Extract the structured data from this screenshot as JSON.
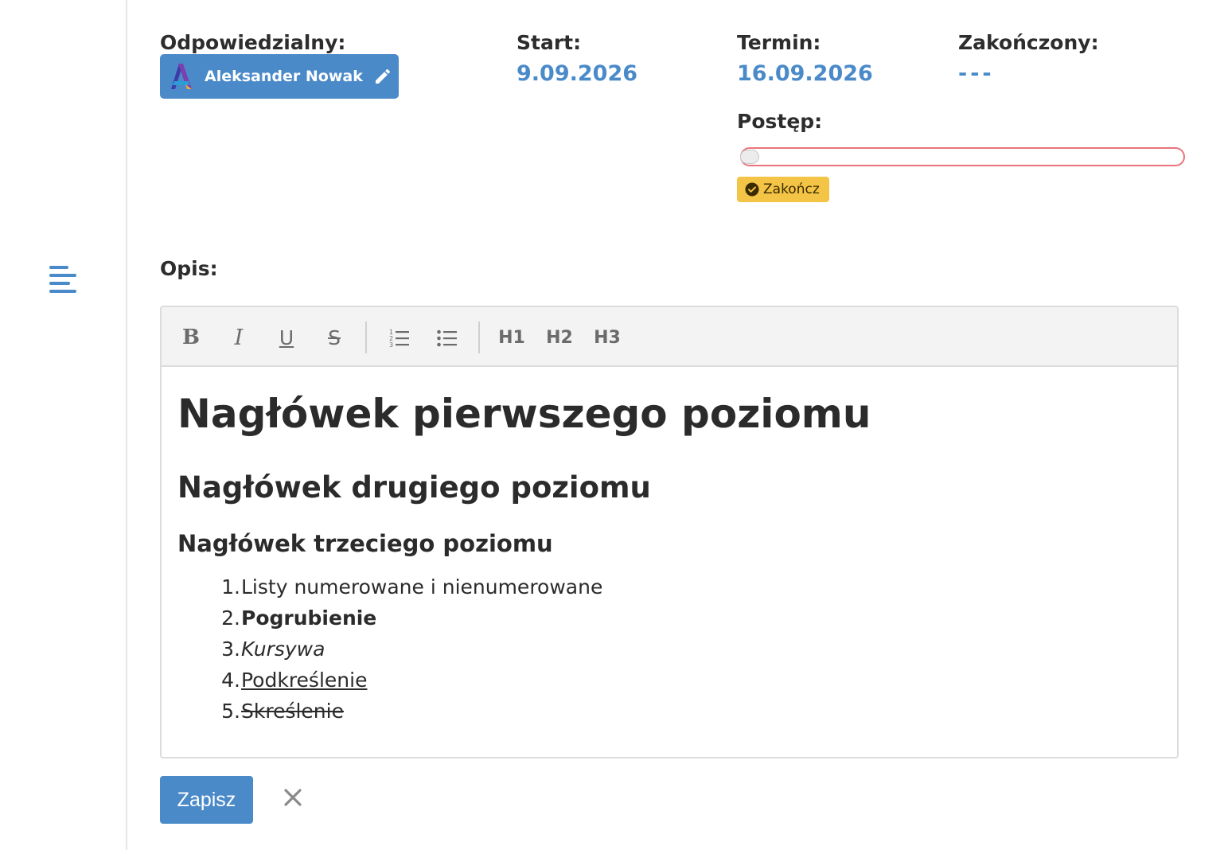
{
  "colors": {
    "accent": "#4a8ac9",
    "progress_border": "#e8747b",
    "finish_button": "#f3c445",
    "label": "#2d2d2d"
  },
  "assignee": {
    "label": "Odpowiedzialny:",
    "name": "Aleksander Nowak",
    "avatar_icon": "assignee-avatar-icon",
    "edit_icon": "pencil-icon"
  },
  "start": {
    "label": "Start:",
    "value": "9.09.2026"
  },
  "deadline": {
    "label": "Termin:",
    "value": "16.09.2026"
  },
  "completed": {
    "label": "Zakończony:",
    "value": "---"
  },
  "progress": {
    "label": "Postęp:",
    "percent": 0
  },
  "finish_button": {
    "label": "Zakończ",
    "icon": "check-circle-icon"
  },
  "description": {
    "label": "Opis:",
    "icon": "align-left-icon",
    "toolbar": {
      "bold": "B",
      "italic": "I",
      "underline": "U",
      "strikethrough": "S",
      "ordered_list_icon": "ordered-list-icon",
      "bullet_list_icon": "bullet-list-icon",
      "h1": "H1",
      "h2": "H2",
      "h3": "H3"
    },
    "content": {
      "h1": "Nagłówek pierwszego poziomu",
      "h2": "Nagłówek drugiego poziomu",
      "h3": "Nagłówek trzeciego poziomu",
      "list": [
        {
          "num": "1.",
          "text": "Listy numerowane i nienumerowane"
        },
        {
          "num": "2.",
          "text": "Pogrubienie"
        },
        {
          "num": "3.",
          "text": "Kursywa"
        },
        {
          "num": "4.",
          "text": "Podkreślenie"
        },
        {
          "num": "5.",
          "text": "Skreślenie"
        }
      ]
    }
  },
  "actions": {
    "save_label": "Zapisz",
    "cancel_icon": "close-icon"
  }
}
